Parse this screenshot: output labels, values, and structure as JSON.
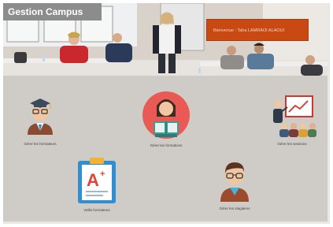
{
  "header": {
    "brand": "Gestion Campus",
    "welcome": "Bienvenue : Taha LAMRAOI ALAOUI"
  },
  "tiles": [
    {
      "label": "Gérer les formateurs",
      "icon": "graduate-icon"
    },
    {
      "label": "Gérer les formations",
      "icon": "reading-woman-icon"
    },
    {
      "label": "Gérer les sessions",
      "icon": "presentation-icon"
    },
    {
      "label": "Veille formateurs",
      "icon": "grade-clipboard-icon"
    },
    {
      "label": "Gérer les stagiaires",
      "icon": "student-icon"
    }
  ],
  "colors": {
    "brand_bg": "#8c8c8c",
    "welcome_bg": "#c84a12",
    "dashboard_bg": "#cfcbc7"
  }
}
